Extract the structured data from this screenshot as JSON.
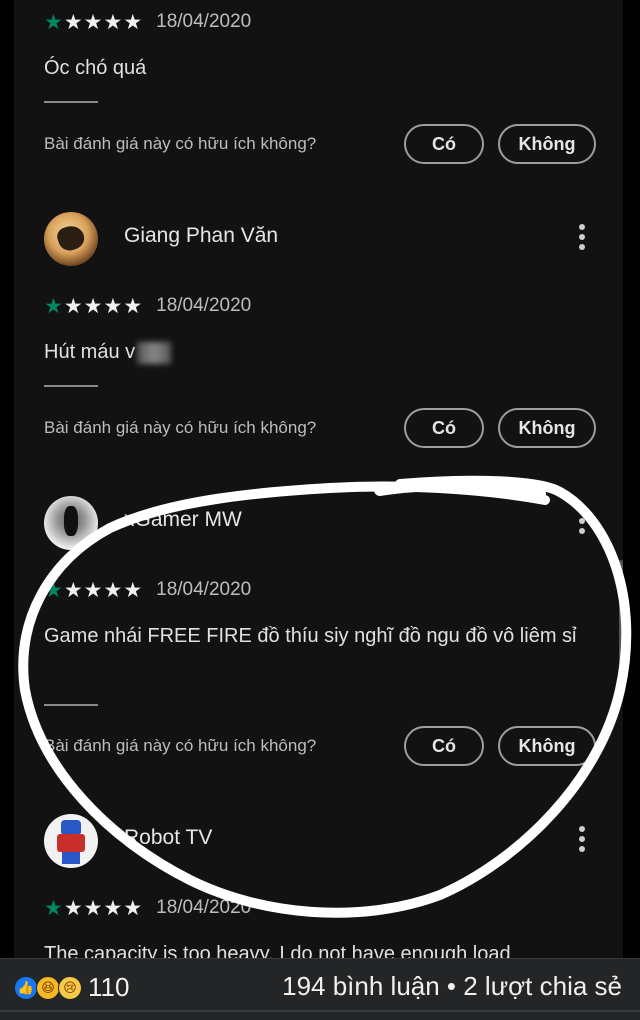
{
  "rating_max": 5,
  "helpful_question": "Bài đánh giá này có hữu ích không?",
  "yes_label": "Có",
  "no_label": "Không",
  "reviews": [
    {
      "author": "",
      "rating": 1,
      "date": "18/04/2020",
      "text": "Óc chó quá"
    },
    {
      "author": "Giang Phan Văn",
      "rating": 1,
      "date": "18/04/2020",
      "text": "Hút máu v"
    },
    {
      "author": "xGamer MW",
      "rating": 1,
      "date": "18/04/2020",
      "text": "Game nhái FREE FIRE đồ thíu siy nghĩ đồ ngu đồ vô liêm sỉ"
    },
    {
      "author": "Robot TV",
      "rating": 1,
      "date": "18/04/2020",
      "text": "The capacity is too heavy. I do not have enough load"
    }
  ],
  "icons": {
    "star": "★",
    "more": "more-vert-icon",
    "like": "👍",
    "haha": "😆",
    "sad": "😢"
  },
  "footer": {
    "reaction_count": "110",
    "comments_shares": "194 bình luận • 2 lượt chia sẻ"
  },
  "colors": {
    "star_filled": "#01875f",
    "star_empty": "#f0f0f0",
    "background": "#121212",
    "footer_bg": "#242526",
    "annotation": "#ffffff"
  }
}
